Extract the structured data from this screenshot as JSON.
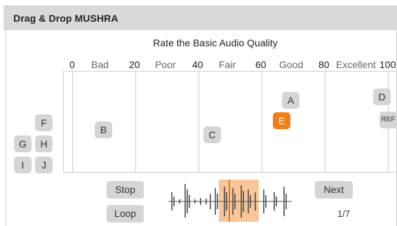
{
  "header": {
    "title": "Drag & Drop MUSHRA"
  },
  "rating": {
    "title": "Rate the Basic Audio Quality",
    "ticks": [
      "0",
      "20",
      "40",
      "60",
      "80",
      "100"
    ],
    "categories": [
      "Bad",
      "Poor",
      "Fair",
      "Good",
      "Excellent"
    ]
  },
  "items": {
    "A": "A",
    "B": "B",
    "C": "C",
    "D": "D",
    "E": "E",
    "F": "F",
    "G": "G",
    "H": "H",
    "I": "I",
    "J": "J",
    "REF": "REF"
  },
  "selected_item": "E",
  "controls": {
    "stop_label": "Stop",
    "loop_label": "Loop",
    "next_label": "Next",
    "page_counter": "1/7"
  },
  "colors": {
    "accent": "#f07f1a",
    "playhead": "#e8751a",
    "loop_region": "#f7c08d",
    "item_bg": "#d5d5d5",
    "header_bg": "#d9d9d9"
  }
}
